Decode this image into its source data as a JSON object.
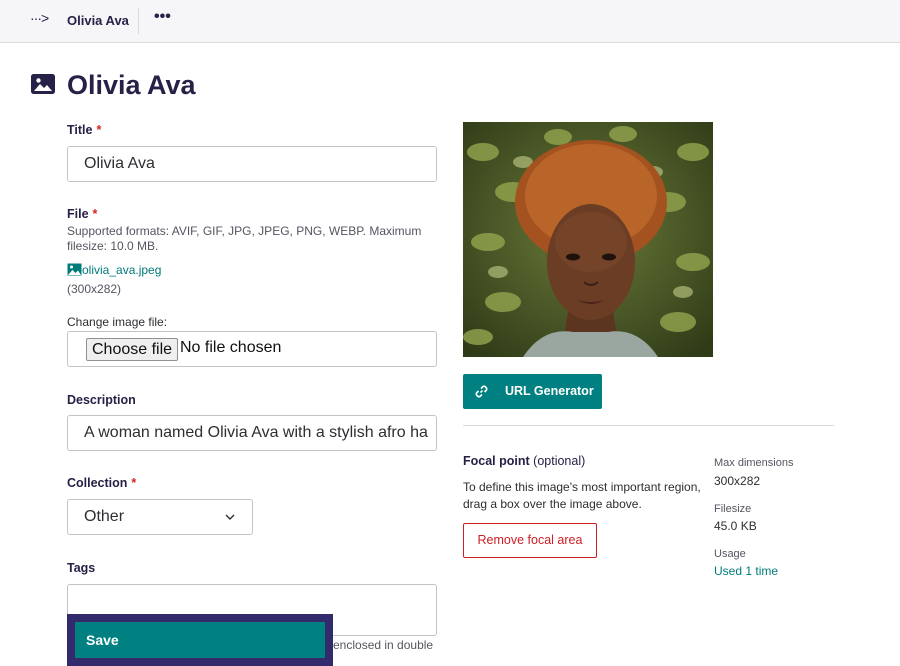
{
  "topbar": {
    "arrow": "···>",
    "breadcrumb": "Olivia Ava",
    "more": "•••"
  },
  "header": {
    "title": "Olivia Ava"
  },
  "form": {
    "title_label": "Title",
    "title_value": "Olivia Ava",
    "required_mark": "*",
    "file_label": "File",
    "file_help": "Supported formats: AVIF, GIF, JPG, JPEG, PNG, WEBP. Maximum filesize: 10.0 MB.",
    "file_name": "olivia_ava.jpeg",
    "file_dims": "(300x282)",
    "change_label": "Change image file:",
    "choose_file": "Choose file",
    "no_file": "No file chosen",
    "description_label": "Description",
    "description_value": "A woman named Olivia Ava with a stylish afro ha",
    "collection_label": "Collection",
    "collection_value": "Other",
    "tags_label": "Tags",
    "tags_help_tail": "enclosed in double",
    "save_label": "Save"
  },
  "sidebar": {
    "url_generator": "URL Generator",
    "focal_title": "Focal point",
    "focal_optional": "(optional)",
    "focal_desc": "To define this image's most important region, drag a box over the image above.",
    "remove_focal": "Remove focal area",
    "max_dim_label": "Max dimensions",
    "max_dim_value": "300x282",
    "filesize_label": "Filesize",
    "filesize_value": "45.0 KB",
    "usage_label": "Usage",
    "usage_value": "Used 1 time"
  },
  "colors": {
    "brand_dark": "#262146",
    "teal": "#008080",
    "danger": "#cd2026",
    "savebar": "#322a6b"
  },
  "icons": [
    "arrow-icon",
    "more-icon",
    "image-icon",
    "link-icon",
    "chevron-down-icon"
  ]
}
